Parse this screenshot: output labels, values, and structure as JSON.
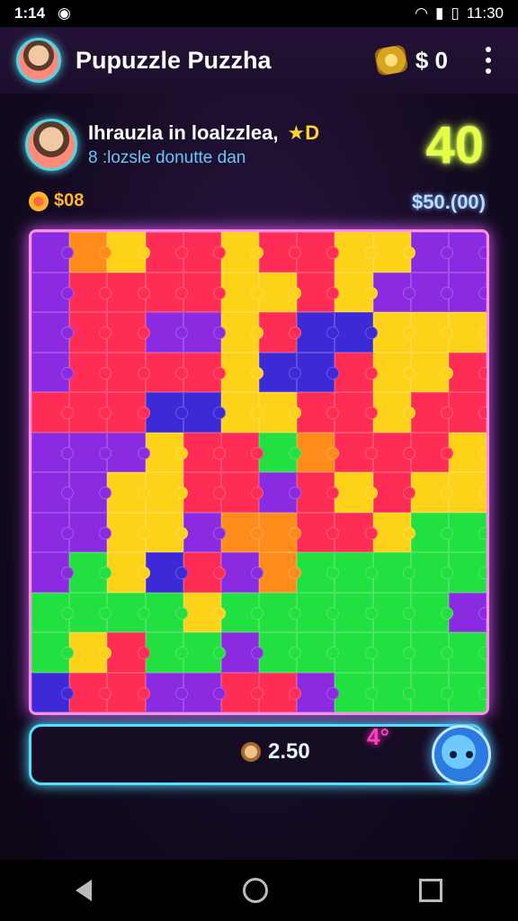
{
  "status": {
    "time_left": "1:14",
    "time_right": "11:30"
  },
  "app": {
    "title": "Pupuzzle Puzzha",
    "coins": "$ 0"
  },
  "player": {
    "name": "Ihrauzla in loalzzlea,",
    "badge": "D",
    "subtitle": "8 :lozsle donutte dan"
  },
  "score": "40",
  "stats": {
    "left": "$08",
    "right": "$50.(00)"
  },
  "bottom": {
    "amount": "2.50",
    "badge": "4°"
  },
  "colors": {
    "accent": "#52e0ff",
    "board_border": "#ff8ee6",
    "score": "#e8ff48"
  },
  "board": {
    "rows": [
      [
        "#8a2be2",
        "#ff8c1a",
        "#ffd21a",
        "#ff2d55",
        "#ff2d55",
        "#ffd21a",
        "#ff2d55",
        "#ff2d55",
        "#ffd21a",
        "#ffd21a",
        "#8a2be2",
        "#8a2be2"
      ],
      [
        "#8a2be2",
        "#ff2d55",
        "#ff2d55",
        "#ff2d55",
        "#ff2d55",
        "#ffd21a",
        "#ffd21a",
        "#ff2d55",
        "#ffd21a",
        "#8a2be2",
        "#8a2be2",
        "#8a2be2"
      ],
      [
        "#8a2be2",
        "#ff2d55",
        "#ff2d55",
        "#8a2be2",
        "#8a2be2",
        "#ffd21a",
        "#ff2d55",
        "#3b2ad6",
        "#3b2ad6",
        "#ffd21a",
        "#ffd21a",
        "#ffd21a"
      ],
      [
        "#8a2be2",
        "#ff2d55",
        "#ff2d55",
        "#ff2d55",
        "#ff2d55",
        "#ffd21a",
        "#3b2ad6",
        "#3b2ad6",
        "#ff2d55",
        "#ffd21a",
        "#ffd21a",
        "#ff2d55"
      ],
      [
        "#ff2d55",
        "#ff2d55",
        "#ff2d55",
        "#3b2ad6",
        "#3b2ad6",
        "#ffd21a",
        "#ffd21a",
        "#ff2d55",
        "#ff2d55",
        "#ffd21a",
        "#ff2d55",
        "#ff2d55"
      ],
      [
        "#8a2be2",
        "#8a2be2",
        "#8a2be2",
        "#ffd21a",
        "#ff2d55",
        "#ff2d55",
        "#22e040",
        "#ff8c1a",
        "#ff2d55",
        "#ff2d55",
        "#ff2d55",
        "#ffd21a"
      ],
      [
        "#8a2be2",
        "#8a2be2",
        "#ffd21a",
        "#ffd21a",
        "#ff2d55",
        "#ff2d55",
        "#8a2be2",
        "#ff2d55",
        "#ffd21a",
        "#ff2d55",
        "#ffd21a",
        "#ffd21a"
      ],
      [
        "#8a2be2",
        "#8a2be2",
        "#ffd21a",
        "#ffd21a",
        "#8a2be2",
        "#ff8c1a",
        "#ff8c1a",
        "#ff2d55",
        "#ff2d55",
        "#ffd21a",
        "#22e040",
        "#22e040"
      ],
      [
        "#8a2be2",
        "#22e040",
        "#ffd21a",
        "#3b2ad6",
        "#ff2d55",
        "#8a2be2",
        "#ff8c1a",
        "#22e040",
        "#22e040",
        "#22e040",
        "#22e040",
        "#22e040"
      ],
      [
        "#22e040",
        "#22e040",
        "#22e040",
        "#22e040",
        "#ffd21a",
        "#22e040",
        "#22e040",
        "#22e040",
        "#22e040",
        "#22e040",
        "#22e040",
        "#8a2be2"
      ],
      [
        "#22e040",
        "#ffd21a",
        "#ff2d55",
        "#22e040",
        "#22e040",
        "#8a2be2",
        "#22e040",
        "#22e040",
        "#22e040",
        "#22e040",
        "#22e040",
        "#22e040"
      ],
      [
        "#3b2ad6",
        "#ff2d55",
        "#ff2d55",
        "#8a2be2",
        "#8a2be2",
        "#ff2d55",
        "#ff2d55",
        "#8a2be2",
        "#22e040",
        "#22e040",
        "#22e040",
        "#22e040"
      ]
    ]
  }
}
